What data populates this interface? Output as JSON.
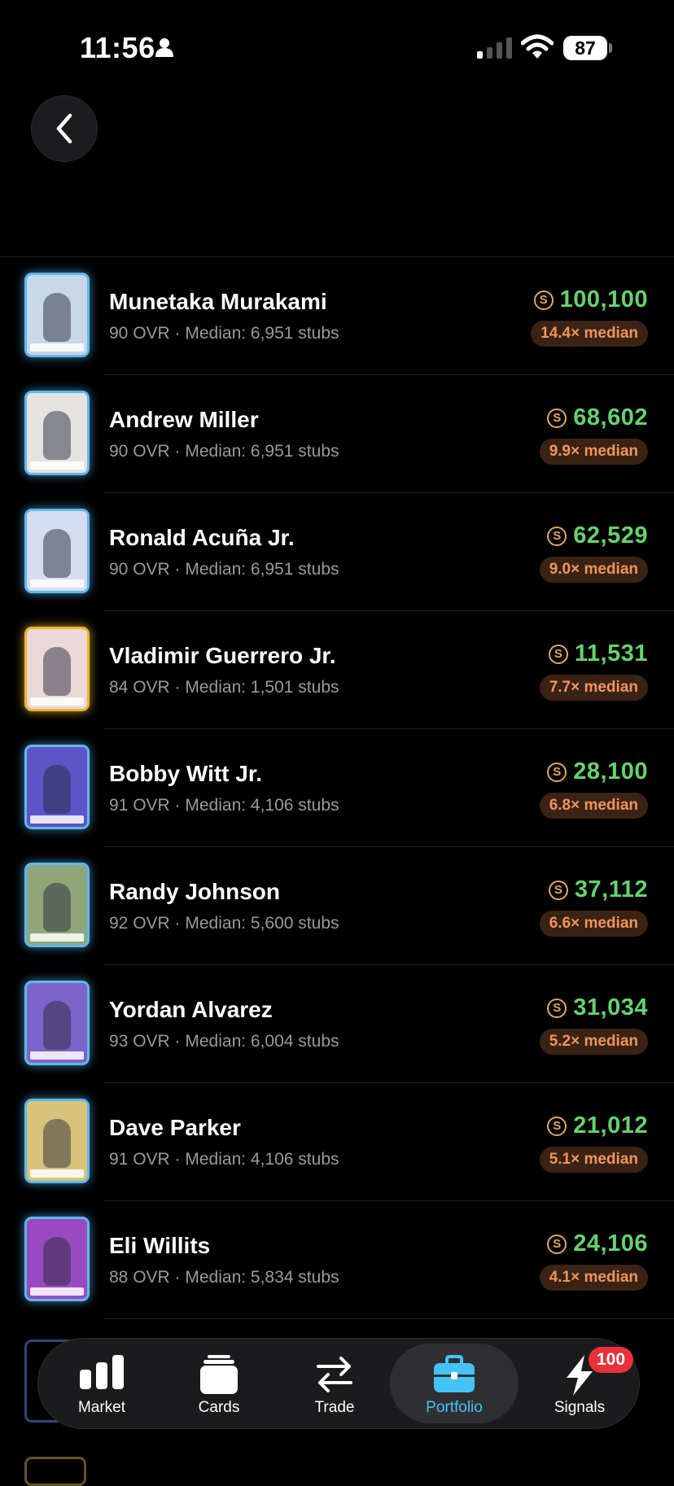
{
  "status_bar": {
    "time": "11:56",
    "battery": "87"
  },
  "players": [
    {
      "name": "Munetaka Murakami",
      "ovr": "90 OVR",
      "median": "Median: 6,951 stubs",
      "price": "100,100",
      "multiple": "14.4× median",
      "card_bg": "#c8d7ea",
      "card_frame": "blue"
    },
    {
      "name": "Andrew Miller",
      "ovr": "90 OVR",
      "median": "Median: 6,951 stubs",
      "price": "68,602",
      "multiple": "9.9× median",
      "card_bg": "#e4e3df",
      "card_frame": "blue"
    },
    {
      "name": "Ronald Acuña Jr.",
      "ovr": "90 OVR",
      "median": "Median: 6,951 stubs",
      "price": "62,529",
      "multiple": "9.0× median",
      "card_bg": "#d6dcf2",
      "card_frame": "blue"
    },
    {
      "name": "Vladimir Guerrero Jr.",
      "ovr": "84 OVR",
      "median": "Median: 1,501 stubs",
      "price": "11,531",
      "multiple": "7.7× median",
      "card_bg": "#ecd8d8",
      "card_frame": "gold"
    },
    {
      "name": "Bobby Witt Jr.",
      "ovr": "91 OVR",
      "median": "Median: 4,106 stubs",
      "price": "28,100",
      "multiple": "6.8× median",
      "card_bg": "#5d54c8",
      "card_frame": "blue"
    },
    {
      "name": "Randy Johnson",
      "ovr": "92 OVR",
      "median": "Median: 5,600 stubs",
      "price": "37,112",
      "multiple": "6.6× median",
      "card_bg": "#8ea67a",
      "card_frame": "blue"
    },
    {
      "name": "Yordan Alvarez",
      "ovr": "93 OVR",
      "median": "Median: 6,004 stubs",
      "price": "31,034",
      "multiple": "5.2× median",
      "card_bg": "#7d64c8",
      "card_frame": "blue"
    },
    {
      "name": "Dave Parker",
      "ovr": "91 OVR",
      "median": "Median: 4,106 stubs",
      "price": "21,012",
      "multiple": "5.1× median",
      "card_bg": "#d8c37a",
      "card_frame": "blue"
    },
    {
      "name": "Eli Willits",
      "ovr": "88 OVR",
      "median": "Median: 5,834 stubs",
      "price": "24,106",
      "multiple": "4.1× median",
      "card_bg": "#9a4ac0",
      "card_frame": "blue"
    }
  ],
  "tabbar": {
    "market": "Market",
    "cards": "Cards",
    "trade": "Trade",
    "portfolio": "Portfolio",
    "signals": "Signals",
    "signals_badge": "100",
    "active": "portfolio"
  },
  "colors": {
    "price": "#65d26e",
    "badge_text": "#f0945a",
    "badge_bg": "#3a2214",
    "active_tab": "#45c3f5",
    "notif": "#e8323a"
  },
  "icons": [
    "person-icon",
    "cellular-signal-icon",
    "wifi-icon",
    "back-chevron-icon",
    "stubs-coin-icon",
    "market-bars-icon",
    "cards-stack-icon",
    "trade-arrows-icon",
    "portfolio-briefcase-icon",
    "signals-bolt-icon"
  ]
}
